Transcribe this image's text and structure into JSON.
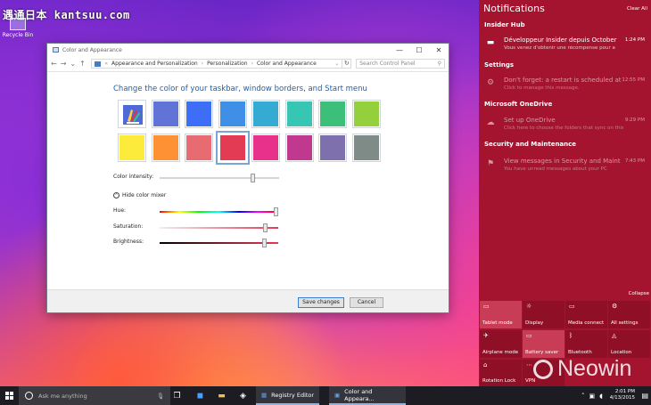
{
  "watermark": "遇通日本 kantsuu.com",
  "desktop": {
    "recycle_bin": "Recycle Bin"
  },
  "dialog": {
    "title": "Color and Appearance",
    "breadcrumbs": [
      "Appearance and Personalization",
      "Personalization",
      "Color and Appearance"
    ],
    "search_placeholder": "Search Control Panel",
    "heading": "Change the color of your taskbar, window borders, and Start menu",
    "swatch_colors": [
      "#6173d7",
      "#3d6ef5",
      "#3f8fe6",
      "#35aad3",
      "#36c6b3",
      "#3bbf79",
      "#94cf3c",
      "#fdeb3b",
      "#ff9135",
      "#e86b71",
      "#e43b55",
      "#e8318a",
      "#c0398f",
      "#7e6fad",
      "#7f8b86"
    ],
    "selected_swatch": "#e43b55",
    "color_intensity_label": "Color intensity:",
    "color_intensity_value": 0.78,
    "hide_mixer_label": "Hide color mixer",
    "hue_label": "Hue:",
    "hue_value": 0.98,
    "saturation_label": "Saturation:",
    "saturation_value": 0.89,
    "brightness_label": "Brightness:",
    "brightness_value": 0.88,
    "save_label": "Save changes",
    "cancel_label": "Cancel"
  },
  "action_center": {
    "title": "Notifications",
    "clear_all": "Clear All",
    "groups": [
      {
        "name": "Insider Hub",
        "title": "Développeur Insider depuis October",
        "body": "Vous venez d'obtenir une récompense pour a",
        "time": "1:24 PM",
        "icon": "megaphone-icon"
      },
      {
        "name": "Settings",
        "title": "Don't forget: a restart is scheduled at",
        "body": "Click to manage this message.",
        "time": "12:55 PM",
        "icon": "gear-icon"
      },
      {
        "name": "Microsoft OneDrive",
        "title": "Set up OneDrive",
        "body": "Click here to choose the folders that sync on this PC",
        "time": "9:29 PM",
        "icon": "cloud-icon"
      },
      {
        "name": "Security and Maintenance",
        "title": "View messages in Security and Maint",
        "body": "You have unread messages about your PC",
        "time": "7:43 PM",
        "icon": "flag-icon"
      }
    ],
    "collapse_label": "Collapse",
    "quick_actions": [
      {
        "label": "Tablet mode",
        "icon": "tablet-icon",
        "on": true
      },
      {
        "label": "Display",
        "icon": "sun-icon",
        "on": false
      },
      {
        "label": "Media connect",
        "icon": "cast-icon",
        "on": false
      },
      {
        "label": "All settings",
        "icon": "gear-icon",
        "on": false
      },
      {
        "label": "Airplane mode",
        "icon": "airplane-icon",
        "on": false
      },
      {
        "label": "Battery saver",
        "icon": "battery-icon",
        "on": true
      },
      {
        "label": "Bluetooth",
        "icon": "bluetooth-icon",
        "on": false
      },
      {
        "label": "Location",
        "icon": "location-icon",
        "on": false
      },
      {
        "label": "Rotation Lock",
        "icon": "rotation-lock-icon",
        "on": false
      },
      {
        "label": "VPN",
        "icon": "vpn-icon",
        "on": false
      }
    ]
  },
  "neowin": "Neowin",
  "taskbar": {
    "search_placeholder": "Ask me anything",
    "tasks": [
      "Registry Editor",
      "Color and Appeara..."
    ],
    "time": "2:01 PM",
    "date": "4/13/2015"
  }
}
